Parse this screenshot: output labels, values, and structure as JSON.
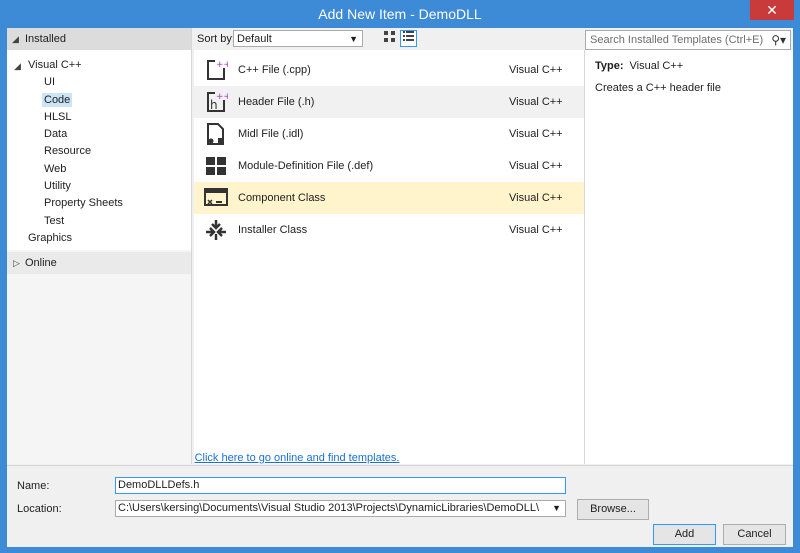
{
  "window": {
    "title": "Add New Item - DemoDLL",
    "close_glyph": "✕"
  },
  "tree": {
    "installed_label": "Installed",
    "visual_cpp_label": "Visual C++",
    "children": [
      "UI",
      "Code",
      "HLSL",
      "Data",
      "Resource",
      "Web",
      "Utility",
      "Property Sheets",
      "Test"
    ],
    "selected": "Code",
    "graphics_label": "Graphics",
    "online_label": "Online"
  },
  "toolbar": {
    "sort_label": "Sort by:",
    "sort_value": "Default",
    "search_placeholder": "Search Installed Templates (Ctrl+E)"
  },
  "templates": [
    {
      "name": "C++ File (.cpp)",
      "lang": "Visual C++",
      "icon": "cpp-file-icon"
    },
    {
      "name": "Header File (.h)",
      "lang": "Visual C++",
      "icon": "header-file-icon"
    },
    {
      "name": "Midl File (.idl)",
      "lang": "Visual C++",
      "icon": "midl-file-icon"
    },
    {
      "name": "Module-Definition File (.def)",
      "lang": "Visual C++",
      "icon": "module-definition-icon"
    },
    {
      "name": "Component Class",
      "lang": "Visual C++",
      "icon": "component-class-icon"
    },
    {
      "name": "Installer Class",
      "lang": "Visual C++",
      "icon": "installer-class-icon"
    }
  ],
  "online_link": "Click here to go online and find templates.",
  "info": {
    "type_label": "Type:",
    "type_value": "Visual C++",
    "description": "Creates a C++ header file"
  },
  "form": {
    "name_label": "Name:",
    "name_value": "DemoDLLDefs.h",
    "location_label": "Location:",
    "location_value": "C:\\Users\\kersing\\Documents\\Visual Studio 2013\\Projects\\DynamicLibraries\\DemoDLL\\",
    "browse_label": "Browse...",
    "add_label": "Add",
    "cancel_label": "Cancel"
  },
  "colors": {
    "accent": "#3d8ad6",
    "selection": "#cce4f7",
    "row_selected": "#fff4cc",
    "link": "#1a6fd6"
  }
}
